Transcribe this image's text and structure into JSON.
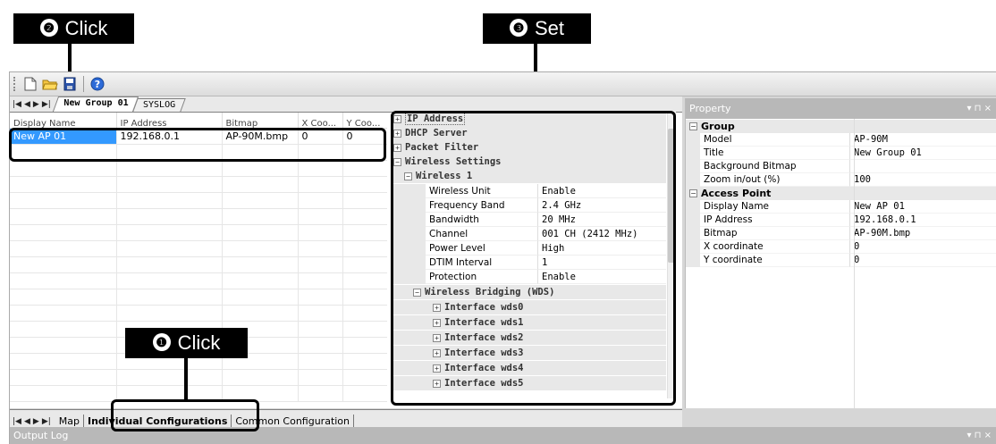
{
  "callouts": [
    {
      "number": "❶",
      "text": "Click"
    },
    {
      "number": "❷",
      "text": "Click"
    },
    {
      "number": "❸",
      "text": "Set"
    }
  ],
  "doc_tabs": [
    {
      "label": "New Group 01",
      "active": true
    },
    {
      "label": "SYSLOG",
      "active": false
    }
  ],
  "grid": {
    "columns": [
      "Display Name",
      "IP Address",
      "Bitmap",
      "X Coo...",
      "Y Coo..."
    ],
    "rows": [
      [
        "New AP 01",
        "192.168.0.1",
        "AP-90M.bmp",
        "0",
        "0"
      ]
    ]
  },
  "config_tree": {
    "categories": [
      "IP Address",
      "DHCP Server",
      "Packet Filter",
      "Wireless Settings"
    ],
    "wireless1": {
      "label": "Wireless 1",
      "items": [
        {
          "key": "Wireless Unit",
          "value": "Enable"
        },
        {
          "key": "Frequency Band",
          "value": "2.4 GHz"
        },
        {
          "key": "Bandwidth",
          "value": "20 MHz"
        },
        {
          "key": "Channel",
          "value": "001 CH (2412 MHz)"
        },
        {
          "key": "Power Level",
          "value": "High"
        },
        {
          "key": "DTIM Interval",
          "value": "1"
        },
        {
          "key": "Protection",
          "value": "Enable"
        }
      ]
    },
    "bridging": {
      "label": "Wireless Bridging (WDS)",
      "interfaces": [
        "Interface wds0",
        "Interface wds1",
        "Interface wds2",
        "Interface wds3",
        "Interface wds4",
        "Interface wds5"
      ]
    }
  },
  "bottom_tabs": [
    {
      "label": "Map",
      "active": false
    },
    {
      "label": "Individual Configurations",
      "active": true
    },
    {
      "label": "Common Configuration",
      "active": false
    }
  ],
  "property": {
    "title": "Property",
    "controls": "▾ ⊓ ×",
    "group": {
      "label": "Group",
      "items": [
        {
          "key": "Model",
          "value": "AP-90M"
        },
        {
          "key": "Title",
          "value": "New Group 01"
        },
        {
          "key": "Background Bitmap",
          "value": ""
        },
        {
          "key": "Zoom in/out (%)",
          "value": "100"
        }
      ]
    },
    "access_point": {
      "label": "Access Point",
      "items": [
        {
          "key": "Display Name",
          "value": "New AP 01"
        },
        {
          "key": "IP Address",
          "value": "192.168.0.1"
        },
        {
          "key": "Bitmap",
          "value": "AP-90M.bmp"
        },
        {
          "key": "X coordinate",
          "value": "0"
        },
        {
          "key": "Y coordinate",
          "value": "0"
        }
      ]
    }
  },
  "output": {
    "title": "Output Log",
    "controls": "▾ ⊓ ×"
  }
}
